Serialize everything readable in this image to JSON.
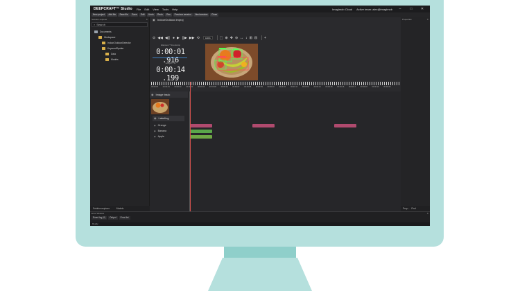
{
  "app": {
    "brand": "DEEPCRAFT™ Studio",
    "menu": [
      "File",
      "Edit",
      "View",
      "Tools",
      "Help"
    ],
    "cloud": "Imagimob Cloud",
    "team": "Active team: alex@imagimob",
    "window_buttons": [
      "–",
      "□",
      "✕"
    ]
  },
  "toolbar": [
    "New project",
    "Add file",
    "Save file",
    "Save",
    "Edit",
    "Undo",
    "Redo",
    "Run",
    "Previous session",
    "Next session",
    "Close"
  ],
  "left_panel": {
    "title": "Solution explorer",
    "search_placeholder": "Search",
    "tree": [
      {
        "label": "Documents",
        "depth": 0,
        "kind": "root"
      },
      {
        "label": "Workspace",
        "depth": 1,
        "kind": "folder"
      },
      {
        "label": "IndoorOutdoorDetector",
        "depth": 2,
        "kind": "folder"
      },
      {
        "label": "KeywordSpotter",
        "depth": 2,
        "kind": "folder"
      },
      {
        "label": "Data",
        "depth": 3,
        "kind": "folder"
      },
      {
        "label": "Models",
        "depth": 3,
        "kind": "folder"
      }
    ],
    "tabs": [
      "Solution explorer",
      "Models"
    ]
  },
  "editor": {
    "file_tab": "IndoorOutdoor.improj",
    "zoom": "100%",
    "elapsed_label": "Elapsed / Timestamp",
    "elapsed": "0:00:01 .916",
    "length_label": "Length / 1x",
    "length": "0:00:14 .199",
    "ruler_labels": [
      "00:00:00",
      "00:00:01",
      "00:00:02",
      "00:00:03",
      "00:00:04",
      "00:00:05",
      "00:00:06",
      "00:00:07",
      "00:00:08",
      "00:00:09",
      "00:00:10",
      "00:00:11",
      "00:00:12",
      "00:00:13",
      "00:00:14",
      "00:00:15",
      "00:00:16",
      "00:00:17",
      "00:00:18",
      "00:00:19",
      "00:00:20"
    ],
    "image_track": "Image track",
    "labeling": "Labeling",
    "labels": [
      "Orange",
      "Banana",
      "Apple"
    ]
  },
  "colors": {
    "orange_label": "#b04a6e",
    "banana_label": "#5aa64a",
    "apple_label": "#6fa845",
    "accent": "#3e82c7",
    "cursor": "#d9534f"
  },
  "right_panel": {
    "title": "Properties",
    "tabs": [
      "Prop...",
      "Find"
    ]
  },
  "bottom_panel": {
    "title": "Error Window",
    "tabs": [
      "Event log (0)",
      "Output",
      "Error list"
    ],
    "status": "Ready"
  }
}
